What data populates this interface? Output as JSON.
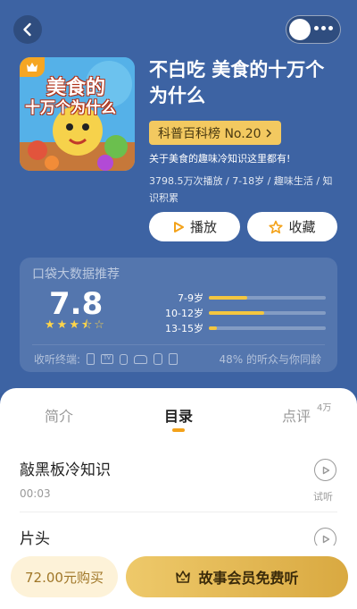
{
  "header": {
    "back_icon": "chevron-left-icon",
    "more_icon": "more-dots-icon"
  },
  "album": {
    "cover_text_line1": "美食的",
    "cover_text_line2": "十万个为什么",
    "title": "不白吃 美食的十万个为什么",
    "rank": "科普百科榜 No.20",
    "description": "关于美食的趣味冷知识这里都有!",
    "meta": "3798.5万次播放 / 7-18岁 / 趣味生活 / 知识积累"
  },
  "actions": {
    "play_label": "播放",
    "favorite_label": "收藏"
  },
  "data_card": {
    "title": "口袋大数据推荐",
    "score": "7.8",
    "stars": 3.5,
    "ages": [
      {
        "label": "7-9岁",
        "fraction": 0.33
      },
      {
        "label": "10-12岁",
        "fraction": 0.47
      },
      {
        "label": "13-15岁",
        "fraction": 0.07
      }
    ],
    "terminals_label": "收听终端:",
    "same_age": "48% 的听众与你同龄"
  },
  "tabs": {
    "intro": "简介",
    "catalog": "目录",
    "reviews": "点评",
    "reviews_count": "4万"
  },
  "episodes": [
    {
      "title": "敲黑板冷知识",
      "duration": "00:03",
      "trial": "试听"
    },
    {
      "title": "片头",
      "duration": "",
      "trial": ""
    }
  ],
  "bottom_bar": {
    "buy_label": "72.00元购买",
    "vip_label": "故事会员免费听"
  },
  "colors": {
    "background": "#3d63a3",
    "accent": "#f3c960",
    "vip_gold": "#e3b655"
  }
}
